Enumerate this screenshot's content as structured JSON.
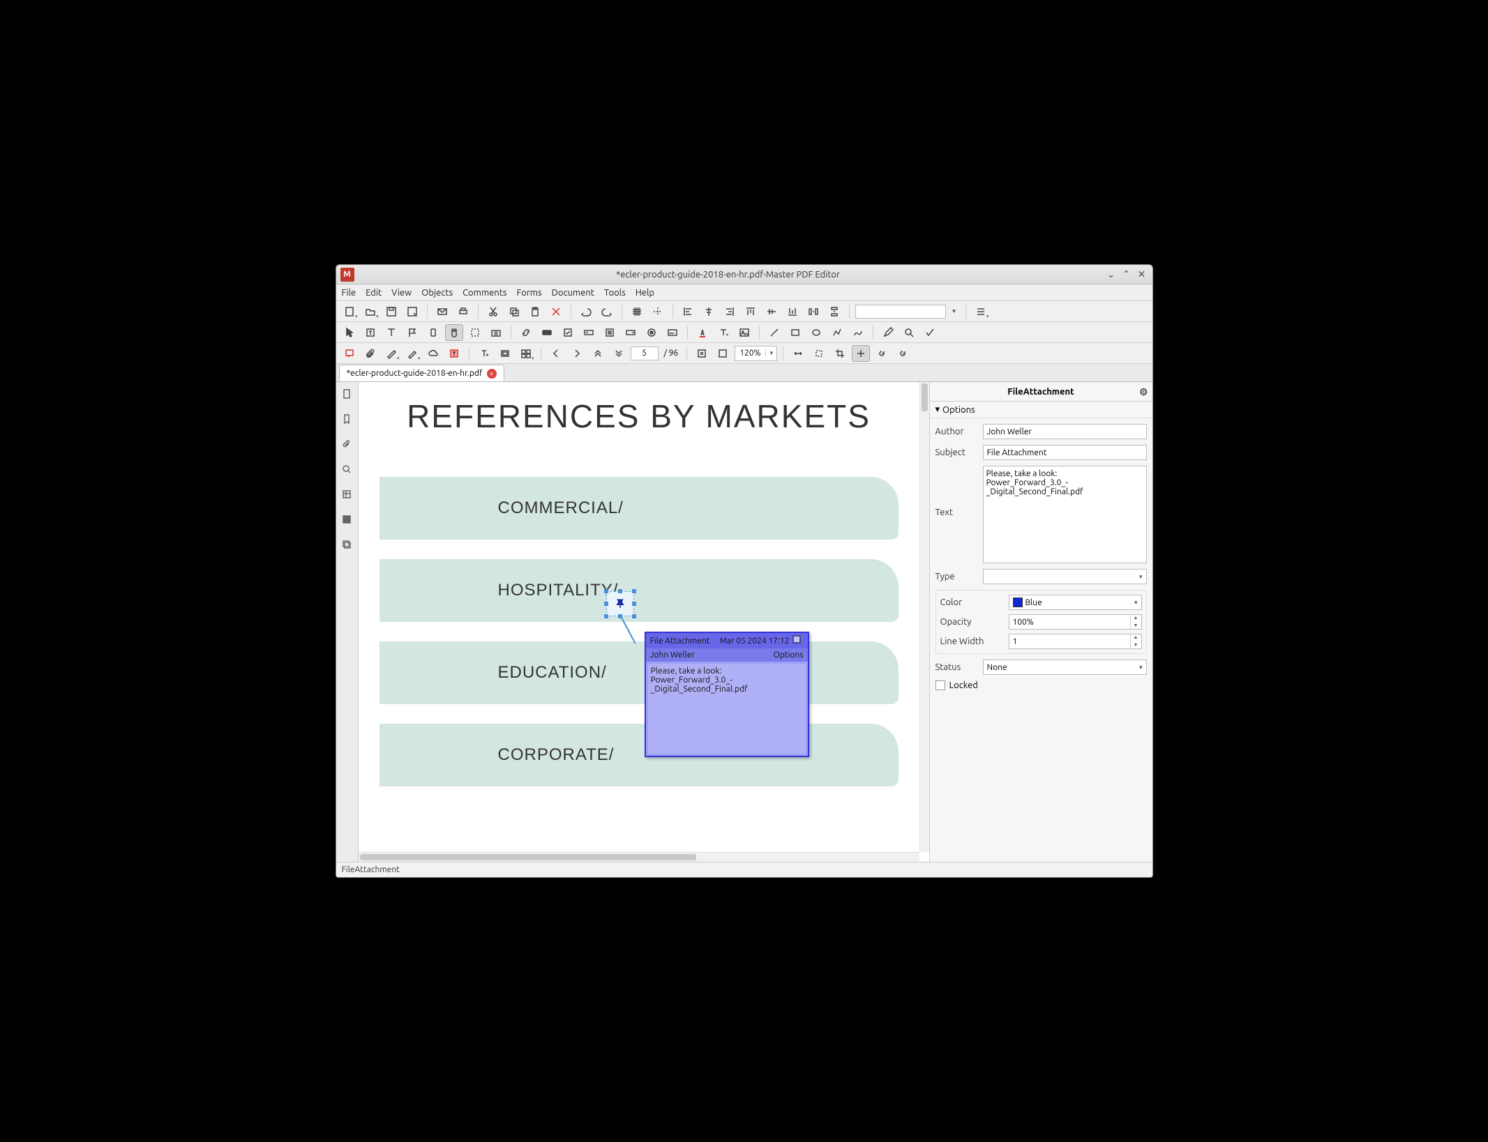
{
  "window": {
    "title": "*ecler-product-guide-2018-en-hr.pdf-Master PDF Editor"
  },
  "menu": {
    "file": "File",
    "edit": "Edit",
    "view": "View",
    "objects": "Objects",
    "comments": "Comments",
    "forms": "Forms",
    "document": "Document",
    "tools": "Tools",
    "help": "Help"
  },
  "nav": {
    "page_current": "5",
    "page_total": "/ 96",
    "zoom": "120%"
  },
  "tab": {
    "name": "*ecler-product-guide-2018-en-hr.pdf"
  },
  "document": {
    "heading": "REFERENCES BY MARKETS",
    "rows": [
      "COMMERCIAL/",
      "HOSPITALITY/",
      "EDUCATION/",
      "CORPORATE/"
    ]
  },
  "note": {
    "title": "File Attachment",
    "date": "Mar 05 2024 17:12",
    "author": "John Weller",
    "options": "Options",
    "body": "Please, take a look:\nPower_Forward_3.0_-_Digital_Second_Final.pdf"
  },
  "panel": {
    "title": "FileAttachment",
    "section": "Options",
    "author_label": "Author",
    "author": "John Weller",
    "subject_label": "Subject",
    "subject": "File Attachment",
    "text_label": "Text",
    "text": "Please, take a look:\nPower_Forward_3.0_-_Digital_Second_Final.pdf",
    "type_label": "Type",
    "type": "",
    "color_label": "Color",
    "color": "Blue",
    "opacity_label": "Opacity",
    "opacity": "100%",
    "linewidth_label": "Line Width",
    "linewidth": "1",
    "status_label": "Status",
    "status": "None",
    "locked": "Locked"
  },
  "status": "FileAttachment"
}
